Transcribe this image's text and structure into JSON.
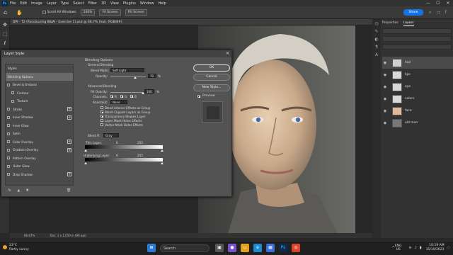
{
  "menubar": {
    "logo": "Ps",
    "items": [
      "File",
      "Edit",
      "Image",
      "Layer",
      "Type",
      "Select",
      "Filter",
      "3D",
      "View",
      "Plugins",
      "Window",
      "Help"
    ],
    "controls": [
      "—",
      "☐",
      "✕"
    ]
  },
  "optionsbar": {
    "scroll_all": "Scroll All Windows",
    "zoom": "100%",
    "fit_screen": "Fit Screen",
    "fill_screen": "Fill Screen",
    "share": "Share"
  },
  "document": {
    "tab_title": "DPI - T2 (Recolouring B&W - Exercise 1).psd @ 66.7% (hair, RGB/8#)",
    "zoom": "66.67%",
    "dimensions": "Doc: 1 x 1,050 in (96 ppi)"
  },
  "panels": {
    "tabs": [
      "Properties",
      "Layers"
    ],
    "active_tab": "Layers",
    "layers": [
      {
        "name": "hair",
        "selected": true
      },
      {
        "name": "lips",
        "selected": false
      },
      {
        "name": "eye",
        "selected": false
      },
      {
        "name": "colors",
        "selected": false
      },
      {
        "name": "face",
        "selected": false
      },
      {
        "name": "old man",
        "selected": false
      }
    ]
  },
  "dialog": {
    "title": "Layer Style",
    "close": "✕",
    "styles_header": "Styles",
    "styles": [
      {
        "label": "Blending Options",
        "type": "selected"
      },
      {
        "label": "Bevel & Emboss",
        "type": "check"
      },
      {
        "label": "Contour",
        "type": "sub"
      },
      {
        "label": "Texture",
        "type": "sub"
      },
      {
        "label": "Stroke",
        "type": "check-plus"
      },
      {
        "label": "Inner Shadow",
        "type": "check-plus"
      },
      {
        "label": "Inner Glow",
        "type": "check"
      },
      {
        "label": "Satin",
        "type": "check"
      },
      {
        "label": "Color Overlay",
        "type": "check-plus"
      },
      {
        "label": "Gradient Overlay",
        "type": "check-plus"
      },
      {
        "label": "Pattern Overlay",
        "type": "check"
      },
      {
        "label": "Outer Glow",
        "type": "check"
      },
      {
        "label": "Drop Shadow",
        "type": "check-plus"
      }
    ],
    "footer_icons": [
      "fx",
      "▲",
      "▼"
    ],
    "trash": "🗑",
    "blending": {
      "section": "Blending Options",
      "general": "General Blending",
      "blend_mode_label": "Blend Mode:",
      "blend_mode_value": "Soft Light",
      "opacity_label": "Opacity:",
      "opacity_value": "70",
      "opacity_fraction": 0.7,
      "percent": "%",
      "advanced": "Advanced Blending",
      "fill_label": "Fill Opacity:",
      "fill_value": "100",
      "fill_fraction": 1.0,
      "channels_label": "Channels:",
      "channels": [
        "R",
        "G",
        "B"
      ],
      "knockout_label": "Knockout:",
      "knockout_value": "None",
      "options": [
        {
          "label": "Blend Interior Effects as Group",
          "checked": false
        },
        {
          "label": "Blend Clipped Layers as Group",
          "checked": true
        },
        {
          "label": "Transparency Shapes Layer",
          "checked": true
        },
        {
          "label": "Layer Mask Hides Effects",
          "checked": false
        },
        {
          "label": "Vector Mask Hides Effects",
          "checked": false
        }
      ],
      "blend_if_label": "Blend If:",
      "blend_if_value": "Gray",
      "this_layer": "This Layer:",
      "this_layer_min": "0",
      "this_layer_max": "255",
      "underlying": "Underlying Layer:",
      "underlying_min": "0",
      "underlying_max": "255"
    },
    "buttons": {
      "ok": "OK",
      "cancel": "Cancel",
      "new_style": "New Style...",
      "preview": "Preview",
      "preview_checked": true
    }
  },
  "taskbar": {
    "temperature": "23°C",
    "weather": "Partly sunny",
    "search": "Search",
    "lang_top": "ENG",
    "lang_bottom": "US",
    "time": "10:19 AM",
    "date": "31/10/2023"
  }
}
